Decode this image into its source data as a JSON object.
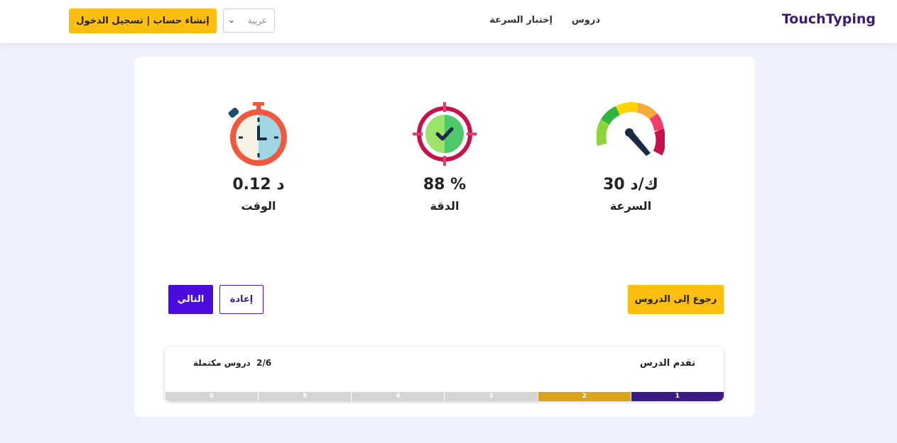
{
  "header": {
    "logo": "TouchTyping",
    "nav": {
      "lessons": "دروس",
      "speed_test": "إختبار السرعة"
    },
    "language_select": {
      "value": "عربية"
    },
    "signup_button": "إنشاء حساب | تسجيل الدخول"
  },
  "stats": {
    "speed": {
      "value": "30 ك/د",
      "label": "السرعة",
      "icon": "speedometer-icon"
    },
    "accuracy": {
      "value": "88 %",
      "label": "الدقة",
      "icon": "target-check-icon"
    },
    "time": {
      "value": "0.12 د",
      "label": "الوقت",
      "icon": "stopwatch-icon"
    }
  },
  "actions": {
    "back_to_lessons": "رجوع إلى الدروس",
    "retry": "إعادة",
    "next": "التالي"
  },
  "progress": {
    "title": "تقدم الدرس",
    "count": "2/6",
    "count_label": "دروس مكتملة",
    "completed": 2,
    "total": 6,
    "segments": [
      "1",
      "2",
      "3",
      "4",
      "5",
      "6"
    ]
  },
  "colors": {
    "accent_purple": "#4b0bdc",
    "accent_yellow": "#fdbf0f",
    "logo": "#3b1a73",
    "progress_done_1": "#3d1a86",
    "progress_done_2": "#dca21c",
    "progress_todo": "#d4d4d4",
    "background": "#eef0fd"
  }
}
